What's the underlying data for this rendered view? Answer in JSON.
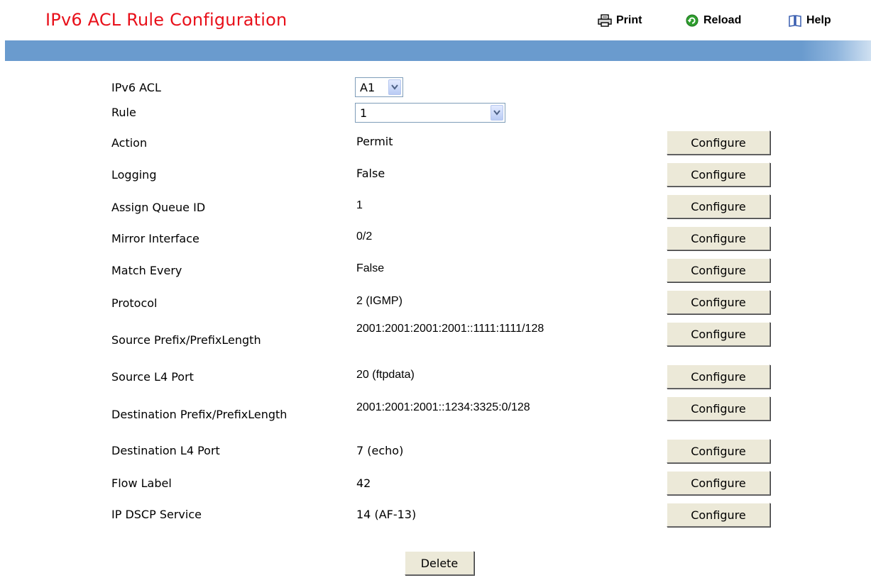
{
  "page": {
    "title": "IPv6 ACL Rule Configuration"
  },
  "toolbar": {
    "print": "Print",
    "reload": "Reload",
    "help": "Help"
  },
  "selectors": {
    "acl": {
      "label": "IPv6 ACL",
      "value": "A1"
    },
    "rule": {
      "label": "Rule",
      "value": "1"
    }
  },
  "rows": [
    {
      "label": "Action",
      "value": "Permit",
      "button": "Configure"
    },
    {
      "label": "Logging",
      "value": "False",
      "button": "Configure"
    },
    {
      "label": "Assign Queue ID",
      "value": "1",
      "button": "Configure"
    },
    {
      "label": "Mirror Interface",
      "value": "0/2",
      "button": "Configure"
    },
    {
      "label": "Match Every",
      "value": "False",
      "button": "Configure"
    },
    {
      "label": "Protocol",
      "value": "2 (IGMP)",
      "button": "Configure"
    },
    {
      "label": "Source Prefix/PrefixLength",
      "value": "2001:2001:2001:2001::1111:1111/128",
      "button": "Configure"
    },
    {
      "label": "Source L4 Port",
      "value": "20 (ftpdata)",
      "button": "Configure"
    },
    {
      "label": "Destination Prefix/PrefixLength",
      "value": "2001:2001:2001::1234:3325:0/128",
      "button": "Configure"
    },
    {
      "label": "Destination L4 Port",
      "value": "7 (echo)",
      "button": "Configure"
    },
    {
      "label": "Flow Label",
      "value": "42",
      "button": "Configure"
    },
    {
      "label": "IP DSCP Service",
      "value": "14 (AF-13)",
      "button": "Configure"
    }
  ],
  "actions": {
    "delete": "Delete"
  },
  "colors": {
    "title": "#e8101a",
    "bar": "#6a9bce",
    "button_face": "#ece9d8"
  },
  "icons": {
    "print": "printer-icon",
    "reload": "reload-icon",
    "help": "book-icon",
    "dropdown": "chevron-down-icon"
  }
}
